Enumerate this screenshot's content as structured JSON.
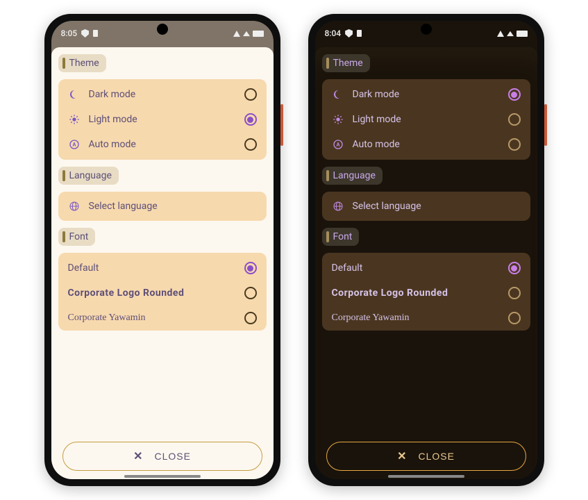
{
  "phones": [
    {
      "themeKey": "light",
      "statusbar": {
        "time": "8:05"
      },
      "sections": {
        "theme": {
          "title": "Theme",
          "options": [
            {
              "icon": "moon",
              "label": "Dark mode",
              "selected": false
            },
            {
              "icon": "sun",
              "label": "Light mode",
              "selected": true
            },
            {
              "icon": "auto",
              "label": "Auto mode",
              "selected": false
            }
          ]
        },
        "language": {
          "title": "Language",
          "action": {
            "icon": "globe",
            "label": "Select language"
          }
        },
        "font": {
          "title": "Font",
          "options": [
            {
              "label": "Default",
              "selected": true,
              "style": "normal"
            },
            {
              "label": "Corporate Logo Rounded",
              "selected": false,
              "style": "bold"
            },
            {
              "label": "Corporate Yawamin",
              "selected": false,
              "style": "serif"
            }
          ]
        }
      },
      "close_label": "CLOSE"
    },
    {
      "themeKey": "dark",
      "statusbar": {
        "time": "8:04"
      },
      "sections": {
        "theme": {
          "title": "Theme",
          "options": [
            {
              "icon": "moon",
              "label": "Dark mode",
              "selected": true
            },
            {
              "icon": "sun",
              "label": "Light mode",
              "selected": false
            },
            {
              "icon": "auto",
              "label": "Auto mode",
              "selected": false
            }
          ]
        },
        "language": {
          "title": "Language",
          "action": {
            "icon": "globe",
            "label": "Select language"
          }
        },
        "font": {
          "title": "Font",
          "options": [
            {
              "label": "Default",
              "selected": true,
              "style": "normal"
            },
            {
              "label": "Corporate Logo Rounded",
              "selected": false,
              "style": "bold"
            },
            {
              "label": "Corporate Yawamin",
              "selected": false,
              "style": "serif"
            }
          ]
        }
      },
      "close_label": "CLOSE"
    }
  ]
}
